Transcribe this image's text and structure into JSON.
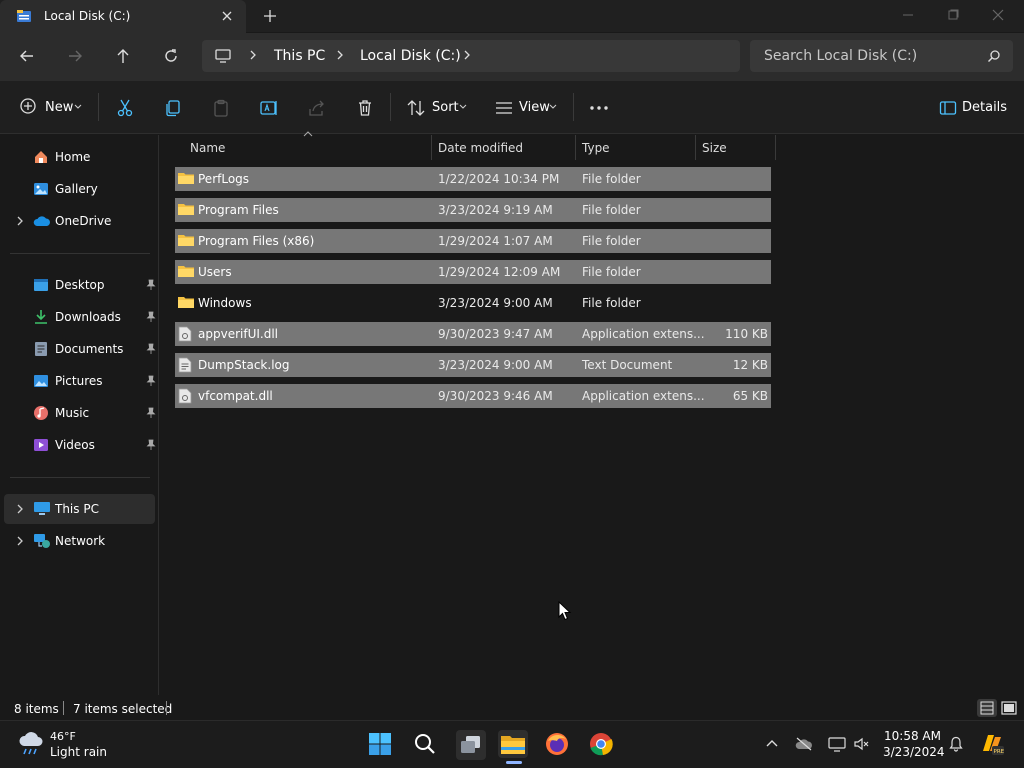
{
  "tab": {
    "title": "Local Disk (C:)"
  },
  "address": {
    "breadcrumb": [
      "This PC",
      "Local Disk (C:)"
    ],
    "search_placeholder": "Search Local Disk (C:)"
  },
  "commands": {
    "new": "New",
    "sort": "Sort",
    "view": "View",
    "details": "Details"
  },
  "sidebar": {
    "items": [
      {
        "label": "Home",
        "icon": "home-icon"
      },
      {
        "label": "Gallery",
        "icon": "gallery-icon"
      },
      {
        "label": "OneDrive",
        "icon": "onedrive-icon"
      },
      {
        "label": "Desktop",
        "icon": "desktop-icon",
        "pinned": true
      },
      {
        "label": "Downloads",
        "icon": "downloads-icon",
        "pinned": true
      },
      {
        "label": "Documents",
        "icon": "documents-icon",
        "pinned": true
      },
      {
        "label": "Pictures",
        "icon": "pictures-icon",
        "pinned": true
      },
      {
        "label": "Music",
        "icon": "music-icon",
        "pinned": true
      },
      {
        "label": "Videos",
        "icon": "videos-icon",
        "pinned": true
      },
      {
        "label": "This PC",
        "icon": "this-pc-icon",
        "selected": true
      },
      {
        "label": "Network",
        "icon": "network-icon"
      }
    ]
  },
  "columns": {
    "name": "Name",
    "date": "Date modified",
    "type": "Type",
    "size": "Size"
  },
  "files": [
    {
      "name": "PerfLogs",
      "date": "1/22/2024 10:34 PM",
      "type": "File folder",
      "size": "",
      "kind": "folder",
      "selected": true
    },
    {
      "name": "Program Files",
      "date": "3/23/2024 9:19 AM",
      "type": "File folder",
      "size": "",
      "kind": "folder",
      "selected": true
    },
    {
      "name": "Program Files (x86)",
      "date": "1/29/2024 1:07 AM",
      "type": "File folder",
      "size": "",
      "kind": "folder",
      "selected": true
    },
    {
      "name": "Users",
      "date": "1/29/2024 12:09 AM",
      "type": "File folder",
      "size": "",
      "kind": "folder",
      "selected": true
    },
    {
      "name": "Windows",
      "date": "3/23/2024 9:00 AM",
      "type": "File folder",
      "size": "",
      "kind": "folder",
      "selected": false
    },
    {
      "name": "appverifUI.dll",
      "date": "9/30/2023 9:47 AM",
      "type": "Application extens...",
      "size": "110 KB",
      "kind": "dll",
      "selected": true
    },
    {
      "name": "DumpStack.log",
      "date": "3/23/2024 9:00 AM",
      "type": "Text Document",
      "size": "12 KB",
      "kind": "text",
      "selected": true
    },
    {
      "name": "vfcompat.dll",
      "date": "9/30/2023 9:46 AM",
      "type": "Application extens...",
      "size": "65 KB",
      "kind": "dll",
      "selected": true
    }
  ],
  "status": {
    "count": "8 items",
    "selected": "7 items selected"
  },
  "taskbar": {
    "weather_temp": "46°F",
    "weather_desc": "Light rain",
    "time": "10:58 AM",
    "date": "3/23/2024"
  },
  "colors": {
    "selection": "#777777",
    "folder": "#f5c242",
    "accent": "#4cc2ff"
  }
}
